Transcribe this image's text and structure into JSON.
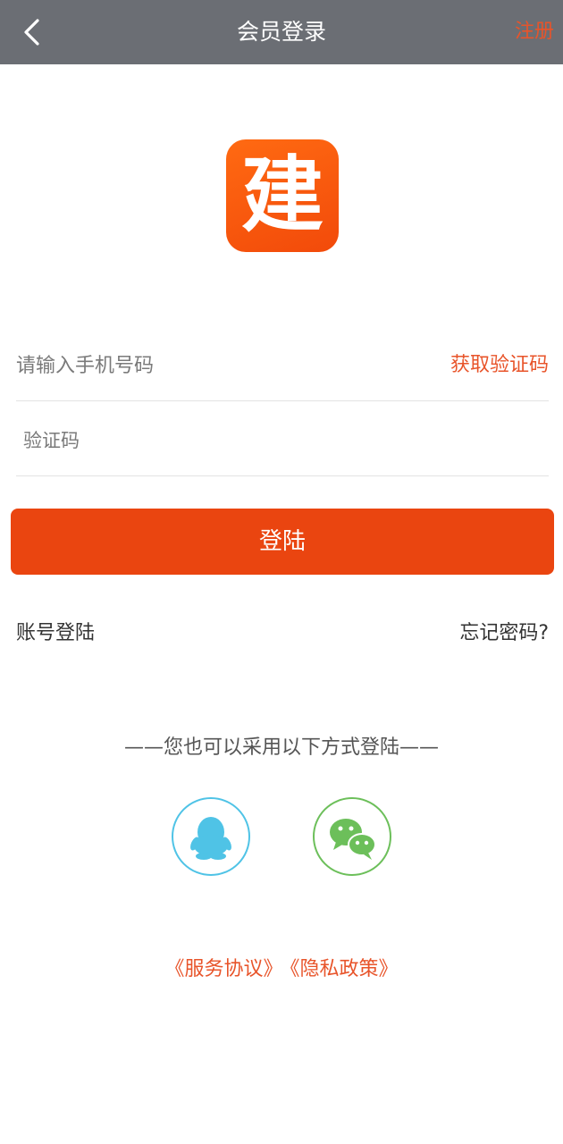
{
  "header": {
    "title": "会员登录",
    "register_label": "注册",
    "back_icon": "chevron-left-icon"
  },
  "logo": {
    "text": "建"
  },
  "form": {
    "phone_placeholder": "请输入手机号码",
    "get_code_label": "获取验证码",
    "code_placeholder": "验证码",
    "login_label": "登陆"
  },
  "links": {
    "account_login": "账号登陆",
    "forgot_password": "忘记密码?"
  },
  "alt_login": {
    "text": "——您也可以采用以下方式登陆——",
    "providers": [
      "qq-icon",
      "wechat-icon"
    ]
  },
  "agreements": {
    "service": "《服务协议》",
    "privacy": "《隐私政策》"
  },
  "colors": {
    "header_bg": "#6b6e74",
    "accent": "#e8542a",
    "button": "#ea4510",
    "qq": "#4fc3e6",
    "wechat": "#6cbf5a"
  }
}
